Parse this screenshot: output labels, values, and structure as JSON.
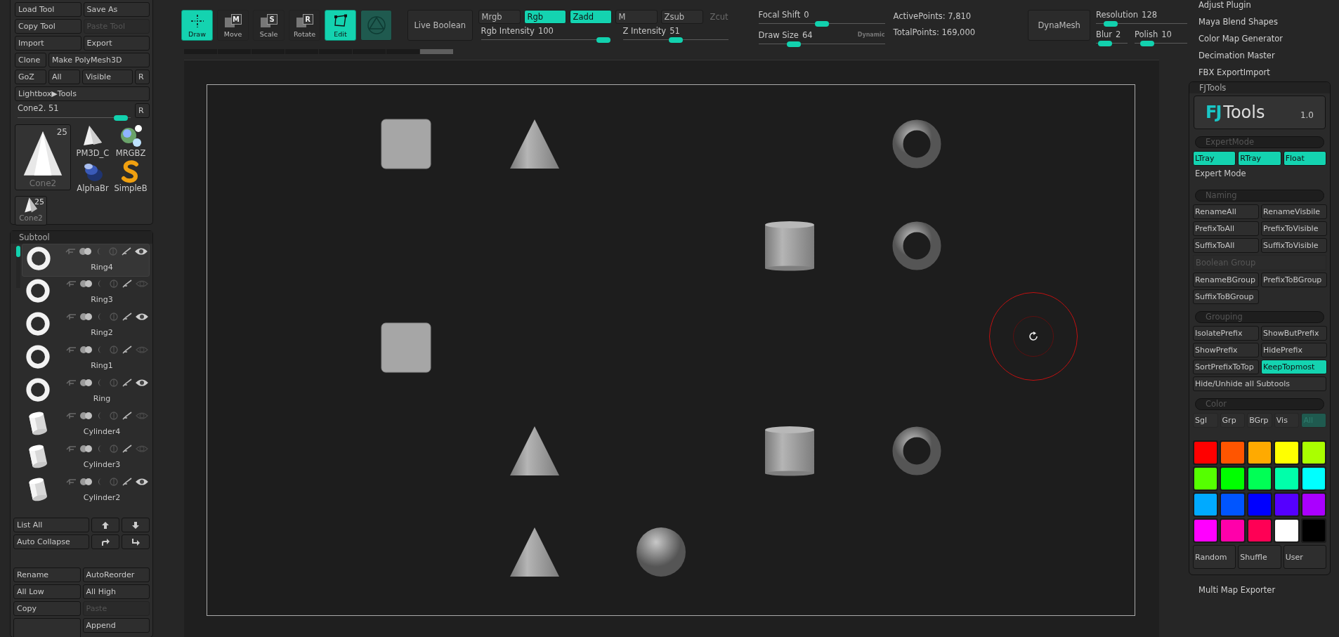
{
  "tool_palette": {
    "rows": [
      [
        {
          "label": "Load Tool",
          "disabled": false
        },
        {
          "label": "Save As",
          "disabled": false
        }
      ],
      [
        {
          "label": "Copy Tool",
          "disabled": false
        },
        {
          "label": "Paste Tool",
          "disabled": true
        }
      ],
      [
        {
          "label": "Import",
          "disabled": false
        },
        {
          "label": "Export",
          "disabled": false
        }
      ],
      [
        {
          "label": "Clone",
          "disabled": false
        },
        {
          "label": "Make PolyMesh3D",
          "disabled": false
        }
      ],
      [
        {
          "label": "GoZ",
          "disabled": false
        },
        {
          "label": "All",
          "disabled": false
        },
        {
          "label": "Visible",
          "disabled": false
        },
        {
          "label": "R",
          "disabled": false
        }
      ],
      [
        {
          "label": "Lightbox▶Tools",
          "disabled": false
        }
      ]
    ],
    "tool_slider": {
      "label": "Cone2. 51",
      "level": 0.97
    },
    "reset_button": "R",
    "current_tool": {
      "name": "Cone2",
      "count": "25"
    },
    "tools": [
      {
        "name": "PM3D_C",
        "kind": "cone"
      },
      {
        "name": "MRGBZ",
        "kind": "spheres"
      },
      {
        "name": "AlphaBr",
        "kind": "brush"
      },
      {
        "name": "SimpleB",
        "kind": "s"
      }
    ],
    "recent_tool": {
      "name": "Cone2",
      "count": "25"
    }
  },
  "subtool": {
    "title": "Subtool",
    "items": [
      {
        "name": "Ring4",
        "kind": "ring",
        "selected": true,
        "visible": true
      },
      {
        "name": "Ring3",
        "kind": "ring",
        "selected": false,
        "visible": false
      },
      {
        "name": "Ring2",
        "kind": "ring",
        "selected": false,
        "visible": true
      },
      {
        "name": "Ring1",
        "kind": "ring",
        "selected": false,
        "visible": false
      },
      {
        "name": "Ring",
        "kind": "ring",
        "selected": false,
        "visible": true
      },
      {
        "name": "Cylinder4",
        "kind": "cylinder",
        "selected": false,
        "visible": false
      },
      {
        "name": "Cylinder3",
        "kind": "cylinder",
        "selected": false,
        "visible": false
      },
      {
        "name": "Cylinder2",
        "kind": "cylinder",
        "selected": false,
        "visible": true
      }
    ],
    "list_all": "List All",
    "auto_collapse": "Auto Collapse",
    "buttons": [
      [
        {
          "label": "Rename",
          "disabled": false
        },
        {
          "label": "AutoReorder",
          "disabled": false
        }
      ],
      [
        {
          "label": "All Low",
          "disabled": false
        },
        {
          "label": "All High",
          "disabled": false
        }
      ],
      [
        {
          "label": "Copy",
          "disabled": false
        },
        {
          "label": "Paste",
          "disabled": true
        }
      ],
      [
        {
          "label": "Append",
          "disabled": false
        }
      ]
    ]
  },
  "toolbar": {
    "tools": [
      {
        "label": "Draw",
        "kind": "draw",
        "on": true
      },
      {
        "label": "Move",
        "kind": "letter",
        "letter": "M",
        "on": false
      },
      {
        "label": "Scale",
        "kind": "letter",
        "letter": "S",
        "on": false
      },
      {
        "label": "Rotate",
        "kind": "letter",
        "letter": "R",
        "on": false
      },
      {
        "label": "Edit",
        "kind": "edit",
        "on": true
      }
    ],
    "live_boolean": "Live Boolean",
    "modes": [
      {
        "label": "Mrgb",
        "on": false,
        "disabled": false
      },
      {
        "label": "Rgb",
        "on": true,
        "disabled": false
      },
      {
        "label": "Zadd",
        "on": true,
        "disabled": false
      },
      {
        "label": "M",
        "on": false,
        "disabled": false
      },
      {
        "label": "Zsub",
        "on": false,
        "disabled": false
      },
      {
        "label": "Zcut",
        "on": false,
        "disabled": true
      }
    ],
    "rgb_intensity": {
      "label": "Rgb Intensity",
      "value": "100",
      "level": 1
    },
    "z_intensity": {
      "label": "Z Intensity",
      "value": "51",
      "level": 0.5
    },
    "focal_shift": {
      "label": "Focal Shift",
      "value": "0",
      "level": 0.5
    },
    "draw_size": {
      "label": "Draw Size",
      "value": "64",
      "level": 0.25
    },
    "dynamic": "Dynamic",
    "active_points": "ActivePoints: 7,810",
    "total_points": "TotalPoints: 169,000",
    "dynamesh": "DynaMesh",
    "resolution": {
      "label": "Resolution",
      "value": "128",
      "level": 0.1
    },
    "blur": {
      "label": "Blur",
      "value": "2",
      "level": 0.1
    },
    "polish": {
      "label": "Polish",
      "value": "10",
      "level": 0.15
    }
  },
  "plugin_menu": [
    "Adjust Plugin",
    "Maya Blend Shapes",
    "Color Map Generator",
    "Decimation Master",
    "FBX ExportImport"
  ],
  "fjtools": {
    "title": "FJTools",
    "logo_mark": "FJ",
    "logo_text": "Tools",
    "version": "1.0",
    "expert_header": "ExpertMode",
    "trays": [
      {
        "label": "LTray",
        "on": true
      },
      {
        "label": "RTray",
        "on": true
      },
      {
        "label": "Float",
        "on": true
      }
    ],
    "expert_label": "Expert Mode",
    "naming_header": "Naming",
    "naming": [
      {
        "label": "RenameAll",
        "on": false
      },
      {
        "label": "RenameVisbile",
        "on": false
      },
      {
        "label": "PrefixToAll",
        "on": false
      },
      {
        "label": "PrefixToVisible",
        "on": false
      },
      {
        "label": "SuffixToAll",
        "on": false
      },
      {
        "label": "SuffixToVisible",
        "on": false
      }
    ],
    "boolean_group": "Boolean Group",
    "bgroup": [
      {
        "label": "RenameBGroup",
        "on": false
      },
      {
        "label": "PrefixToBGroup",
        "on": false
      },
      {
        "label": "SuffixToBGroup",
        "on": false
      }
    ],
    "grouping_header": "Grouping",
    "grouping": [
      {
        "label": "IsolatePrefix",
        "on": false
      },
      {
        "label": "ShowButPrefix",
        "on": false
      },
      {
        "label": "ShowPrefix",
        "on": false
      },
      {
        "label": "HidePrefix",
        "on": false
      },
      {
        "label": "SortPrefixToTop",
        "on": false
      },
      {
        "label": "KeepTopmost",
        "on": true
      }
    ],
    "hide_all": "Hide/Unhide all Subtools",
    "color": {
      "header": "Color",
      "scopes": [
        {
          "label": "Sgl",
          "selected": false
        },
        {
          "label": "Grp",
          "selected": false
        },
        {
          "label": "BGrp",
          "selected": false
        },
        {
          "label": "Vis",
          "selected": false
        },
        {
          "label": "All",
          "selected": true
        }
      ],
      "swatches": [
        {
          "color": "#ff0000"
        },
        {
          "color": "#ff5500"
        },
        {
          "color": "#ffaa00"
        },
        {
          "color": "#ffff00"
        },
        {
          "color": "#aaff00"
        },
        {
          "color": "#55ff00"
        },
        {
          "color": "#00ff00"
        },
        {
          "color": "#00ff55"
        },
        {
          "color": "#00ffaa"
        },
        {
          "color": "#00ffff"
        },
        {
          "color": "#00aaff"
        },
        {
          "color": "#0055ff"
        },
        {
          "color": "#0000ff"
        },
        {
          "color": "#5500ff"
        },
        {
          "color": "#aa00ff"
        },
        {
          "color": "#ff00ff"
        },
        {
          "color": "#ff00aa"
        },
        {
          "color": "#ff0055"
        },
        {
          "color": "#ffffff"
        },
        {
          "color": "#000000"
        }
      ],
      "actions": [
        "Random",
        "Shuffle",
        "User"
      ]
    }
  },
  "footer_plugin": "Multi Map Exporter"
}
